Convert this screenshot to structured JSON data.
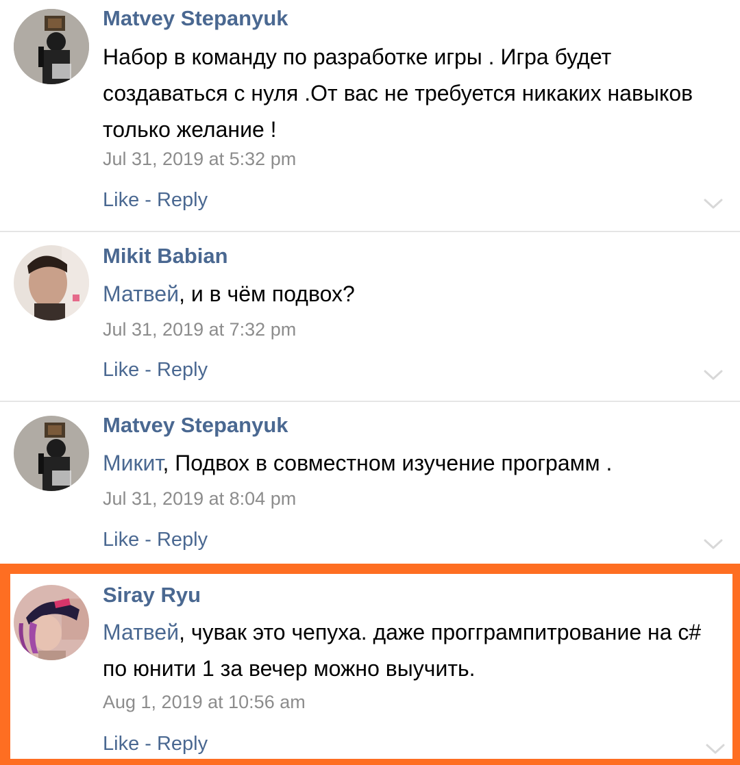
{
  "comments": [
    {
      "author": "Matvey Stepanyuk",
      "mention": "",
      "text": "Набор в команду по разработке игры . Игра будет создаваться с нуля .От вас не требуется никаких навыков только желание !",
      "date": "Jul 31, 2019 at 5:32 pm",
      "like_label": "Like",
      "separator": " - ",
      "reply_label": "Reply",
      "avatar_icon": "avatar-matvey"
    },
    {
      "author": "Mikit Babian",
      "mention": "Матвей",
      "text": ", и в чём подвох?",
      "date": "Jul 31, 2019 at 7:32 pm",
      "like_label": "Like",
      "separator": " - ",
      "reply_label": "Reply",
      "avatar_icon": "avatar-mikit"
    },
    {
      "author": "Matvey Stepanyuk",
      "mention": "Микит",
      "text": ", Подвох в совместном изучение программ .",
      "date": "Jul 31, 2019 at 8:04 pm",
      "like_label": "Like",
      "separator": " - ",
      "reply_label": "Reply",
      "avatar_icon": "avatar-matvey"
    },
    {
      "author": "Siray Ryu",
      "mention": "Матвей",
      "text": ", чувак это чепуха. даже проггрампитрование на с# по юнити 1 за вечер можно выучить.",
      "date": "Aug 1, 2019 at 10:56 am",
      "like_label": "Like",
      "separator": " - ",
      "reply_label": "Reply",
      "avatar_icon": "avatar-siray"
    }
  ],
  "colors": {
    "link": "#4a6891",
    "text": "#000000",
    "date": "#8c8c8c",
    "highlight_border": "#fe6e22",
    "divider": "#e5e5e5"
  }
}
